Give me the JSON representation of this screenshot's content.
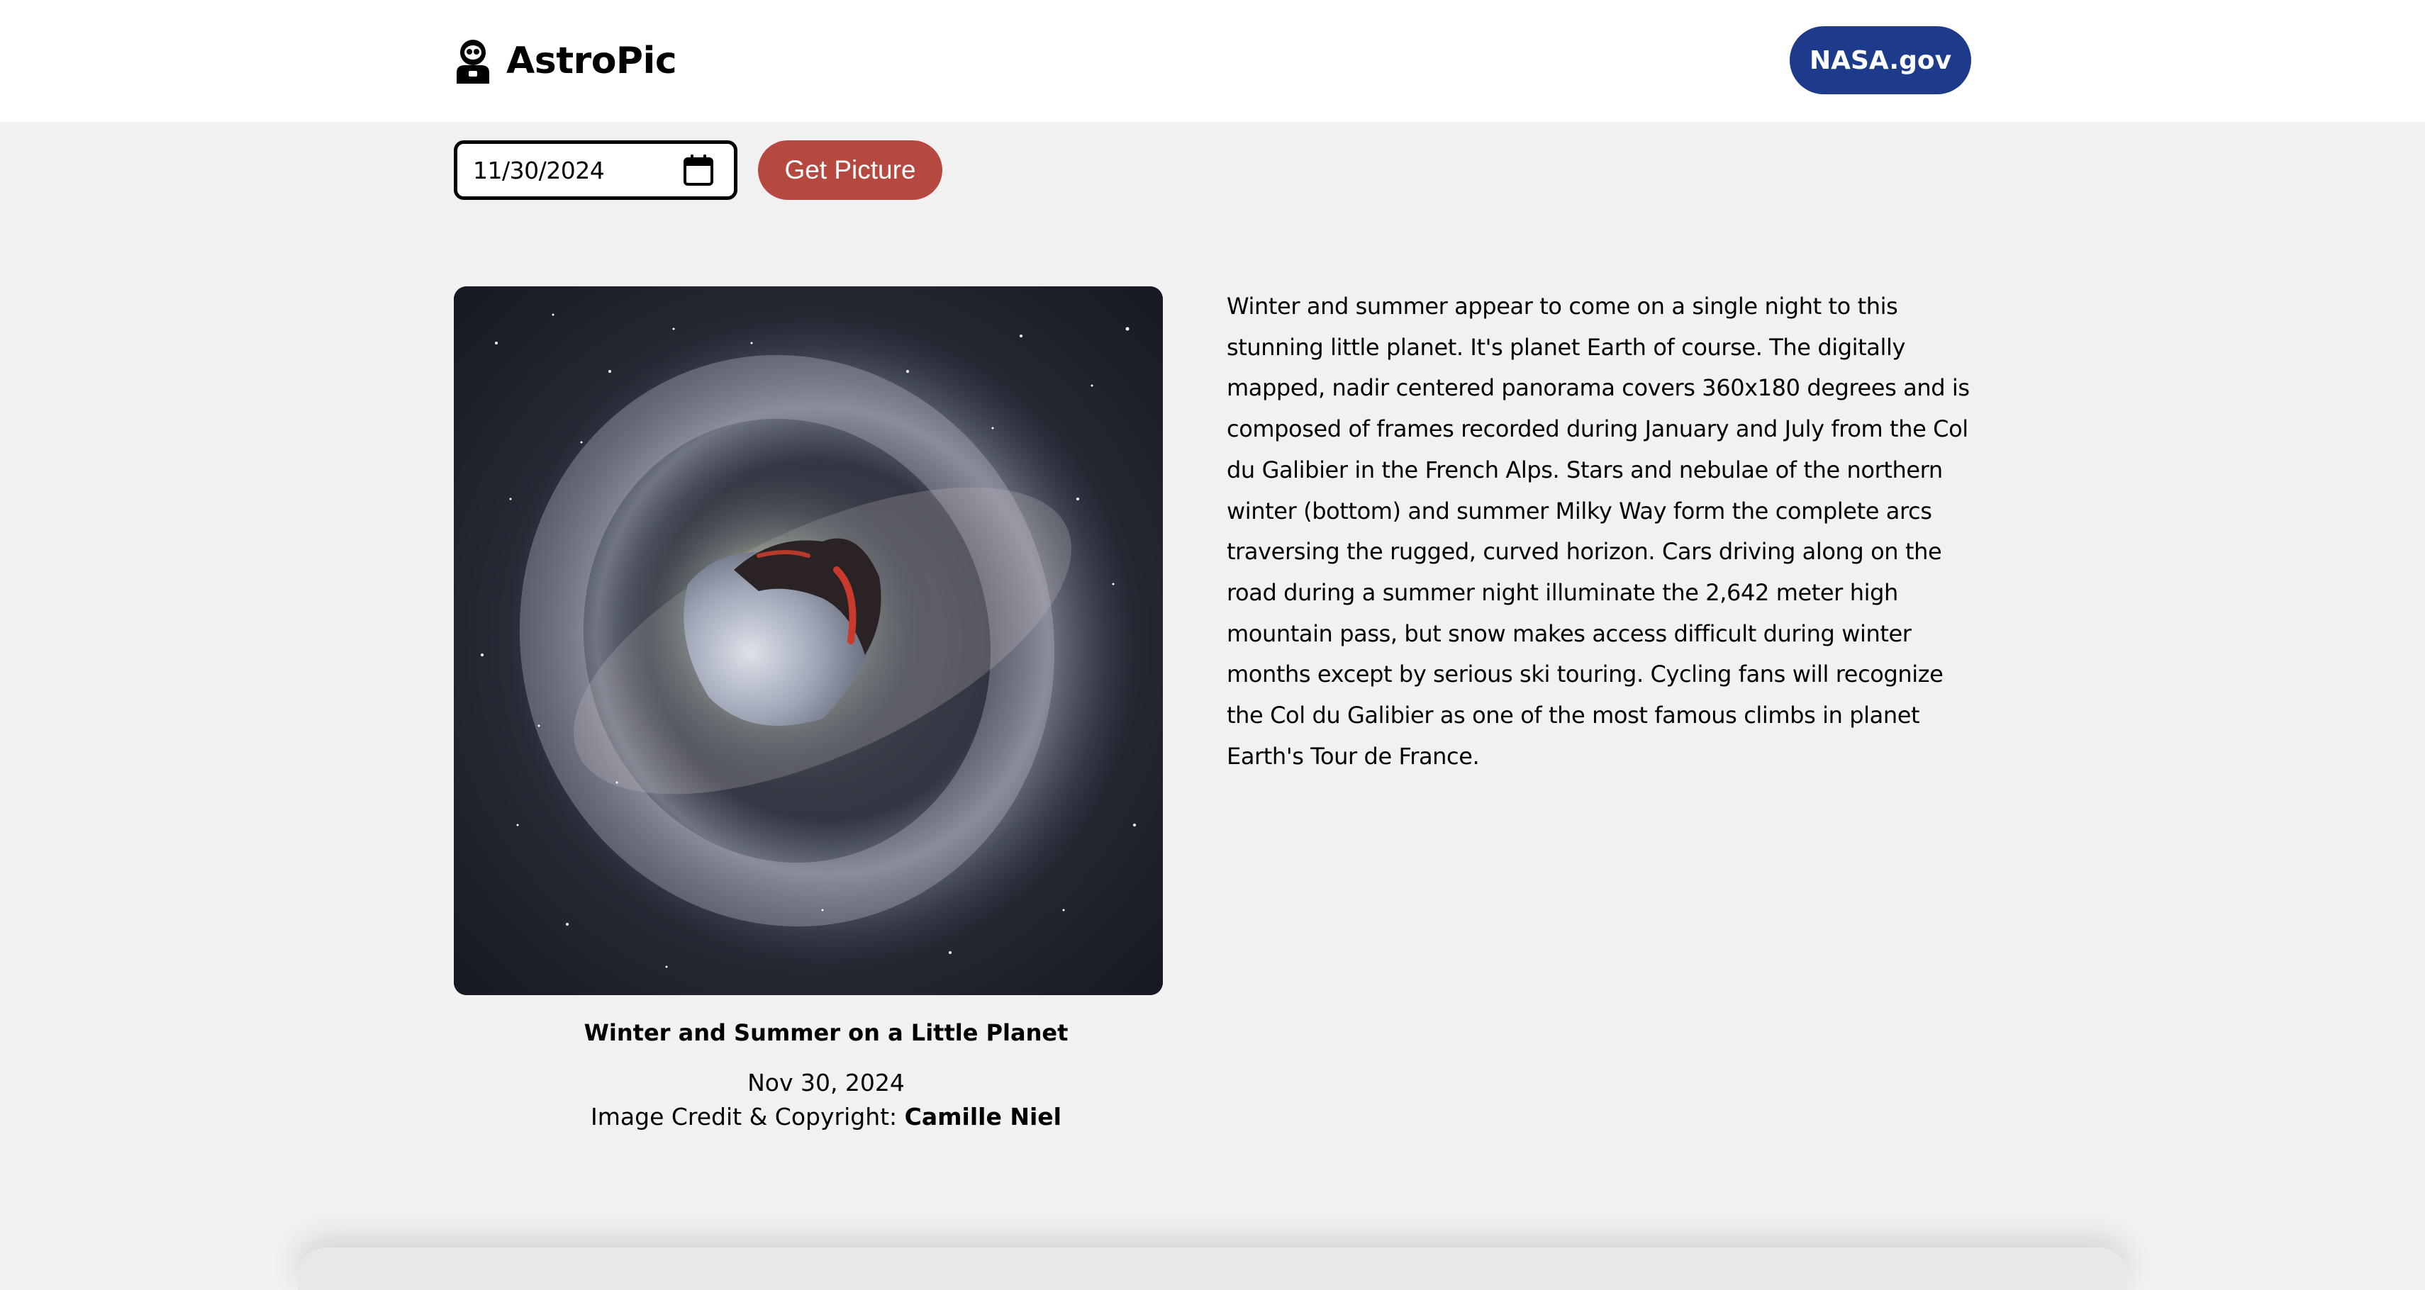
{
  "header": {
    "brand_name": "AstroPic",
    "nasa_button_label": "NASA.gov",
    "brand_icon": "astronaut-icon"
  },
  "controls": {
    "date_value": "11/30/2024",
    "calendar_icon": "calendar-icon",
    "get_button_label": "Get Picture"
  },
  "apod": {
    "image_alt": "Winter and Summer on a Little Planet",
    "title": "Winter and Summer on a Little Planet",
    "date": "Nov 30, 2024",
    "credit_label": "Image Credit & Copyright: ",
    "credit_name": "Camille Niel",
    "explanation": "Winter and summer appear to come on a single night to this stunning little planet. It's planet Earth of course. The digitally mapped, nadir centered panorama covers 360x180 degrees and is composed of frames recorded during January and July from the Col du Galibier in the French Alps. Stars and nebulae of the northern winter (bottom) and summer Milky Way form the complete arcs traversing the rugged, curved horizon. Cars driving along on the road during a summer night illuminate the 2,642 meter high mountain pass, but snow makes access difficult during winter months except by serious ski touring. Cycling fans will recognize the Col du Galibier as one of the most famous climbs in planet Earth's Tour de France."
  },
  "colors": {
    "page_background": "#f1f1f1",
    "header_background": "#ffffff",
    "nasa_button": "#1e3a8a",
    "get_button": "#b5493f"
  }
}
